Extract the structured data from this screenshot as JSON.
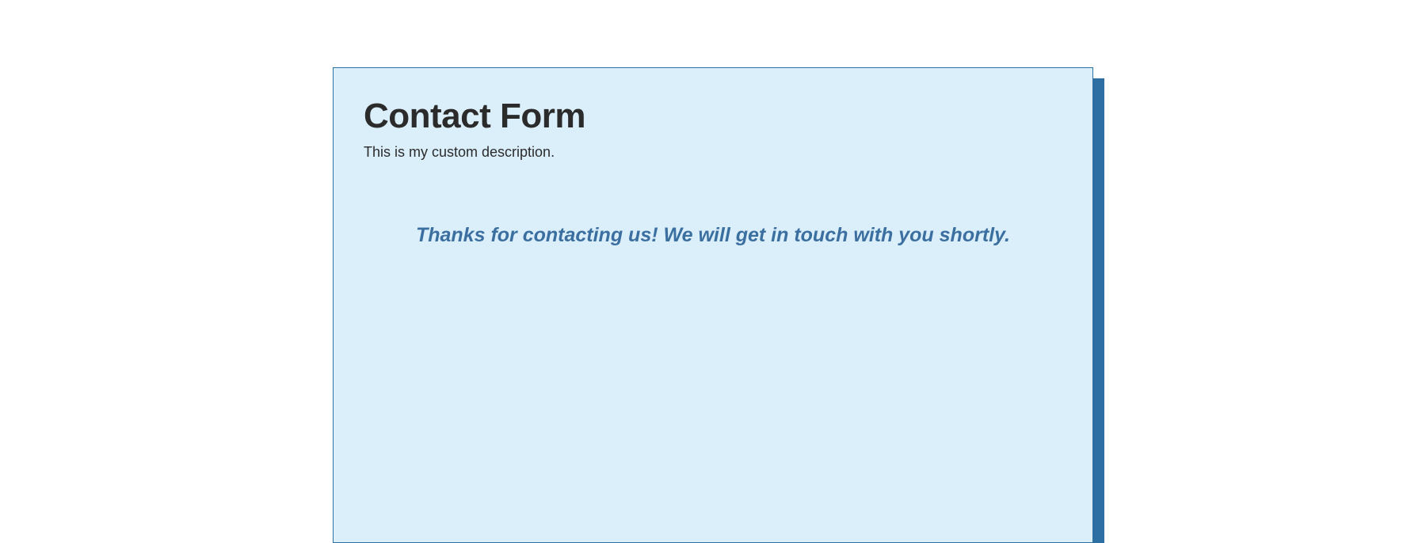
{
  "form": {
    "title": "Contact Form",
    "description": "This is my custom description.",
    "confirmation": "Thanks for contacting us! We will get in touch with you shortly."
  }
}
